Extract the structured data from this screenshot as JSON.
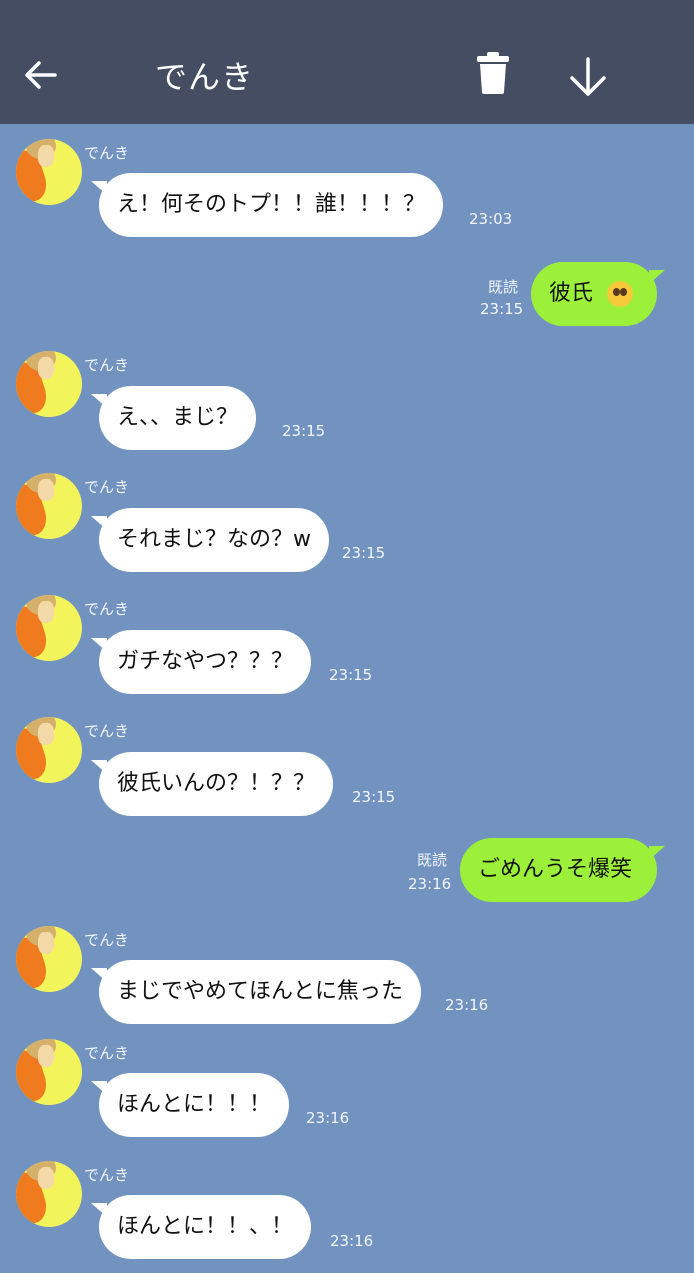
{
  "header": {
    "title": "でんき",
    "back_icon": "arrow-left-icon",
    "trash_icon": "trash-icon",
    "download_icon": "arrow-down-icon",
    "background": "#444d62"
  },
  "colors": {
    "chat_background": "#7293bf",
    "incoming_bubble": "#ffffff",
    "outgoing_bubble": "#9cf03a"
  },
  "messages": [
    {
      "from": "でんき",
      "text": "え！何そのトプ！！誰！！！？",
      "time": "23:03"
    },
    {
      "text": "彼氏",
      "emoji": "pleading-face-emoji",
      "read": "既読",
      "time": "23:15"
    },
    {
      "from": "でんき",
      "text": "え、、まじ？",
      "time": "23:15"
    },
    {
      "from": "でんき",
      "text": "それまじ？なの？w",
      "time": "23:15"
    },
    {
      "from": "でんき",
      "text": "ガチなやつ？？？",
      "time": "23:15"
    },
    {
      "from": "でんき",
      "text": "彼氏いんの？！？？",
      "time": "23:15"
    },
    {
      "text": "ごめんうそ爆笑",
      "read": "既読",
      "time": "23:16"
    },
    {
      "from": "でんき",
      "text": "まじでやめてほんとに焦った",
      "time": "23:16"
    },
    {
      "from": "でんき",
      "text": "ほんとに！！！",
      "time": "23:16"
    },
    {
      "from": "でんき",
      "text": "ほんとに！！、！",
      "time": "23:16"
    }
  ]
}
